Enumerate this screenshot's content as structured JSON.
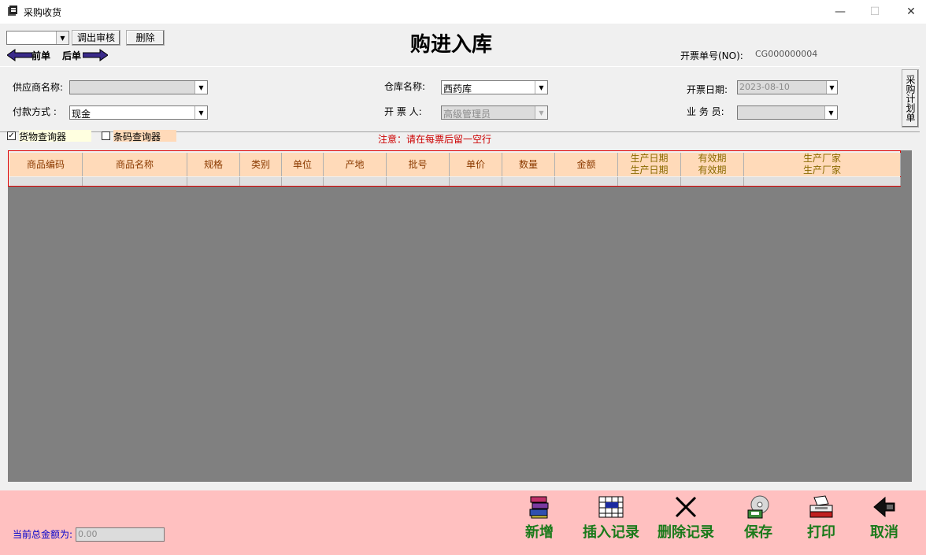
{
  "window": {
    "title": "采购收货",
    "min_icon": "—",
    "max_icon": "☐",
    "close_icon": "✕"
  },
  "toolbar": {
    "combo_value": "",
    "recall_audit_button": "调出审核",
    "delete_button": "删除",
    "prev_label": "前单",
    "next_label": "后单"
  },
  "header": {
    "title": "购进入库",
    "invoice_no_label": "开票单号(NO):",
    "invoice_no_value": "CG000000004"
  },
  "form": {
    "supplier_label": "供应商名称:",
    "supplier_value": "",
    "payment_label": "付款方式  :",
    "payment_value": "现金",
    "warehouse_label": "仓库名称:",
    "warehouse_value": "西药库",
    "issuer_label": "开 票 人:",
    "issuer_value": "高级管理员",
    "date_label": "开票日期:",
    "date_value": "2023-08-10",
    "salesman_label": "业 务 员:",
    "salesman_value": ""
  },
  "side_tab": {
    "label": "采购计划单"
  },
  "options": {
    "goods_finder_label": "货物查询器",
    "goods_finder_checked": true,
    "barcode_finder_label": "条码查询器",
    "barcode_finder_checked": false,
    "notice": "注意：请在每票后留一空行"
  },
  "grid": {
    "columns": [
      "商品编码",
      "商品名称",
      "规格",
      "类别",
      "单位",
      "产地",
      "批号",
      "单价",
      "数量",
      "金额"
    ],
    "stacked_columns": [
      "生产日期",
      "有效期",
      "生产厂家"
    ]
  },
  "actions": {
    "new": "新增",
    "insert": "插入记录",
    "delete": "删除记录",
    "save": "保存",
    "print": "打印",
    "cancel": "取消"
  },
  "footer": {
    "total_label": "当前总金额为:",
    "total_value": "0.00"
  },
  "colors": {
    "header_fill": "#ffdab9",
    "bottom_panel": "#ffc0c0",
    "grid_bg": "#808080",
    "action_text": "#1a7a1a",
    "notice_text": "#cc0000"
  }
}
